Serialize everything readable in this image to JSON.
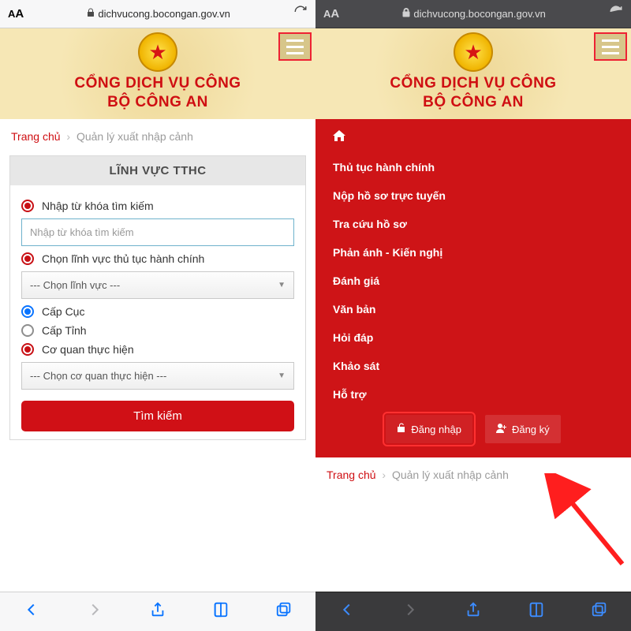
{
  "url": "dichvucong.bocongan.gov.vn",
  "header": {
    "title1": "CỔNG DỊCH VỤ CÔNG",
    "title2": "BỘ CÔNG AN"
  },
  "breadcrumb": {
    "home": "Trang chủ",
    "current": "Quản lý xuất nhập cảnh"
  },
  "panel": {
    "title": "LĨNH VỰC TTHC",
    "keyword_label": "Nhập từ khóa tìm kiếm",
    "keyword_placeholder": "Nhập từ khóa tìm kiếm",
    "field_label": "Chọn lĩnh vực thủ tục hành chính",
    "field_select": "--- Chọn lĩnh vực ---",
    "level_cuc": "Cấp Cục",
    "level_tinh": "Cấp Tỉnh",
    "agency_label": "Cơ quan thực hiện",
    "agency_select": "--- Chọn cơ quan thực hiện ---",
    "search_btn": "Tìm kiếm"
  },
  "menu": {
    "items": [
      "Thủ tục hành chính",
      "Nộp hồ sơ trực tuyến",
      "Tra cứu hồ sơ",
      "Phản ánh - Kiến nghị",
      "Đánh giá",
      "Văn bản",
      "Hỏi đáp",
      "Khảo sát",
      "Hỗ trợ"
    ],
    "login": "Đăng nhập",
    "register": "Đăng ký"
  }
}
